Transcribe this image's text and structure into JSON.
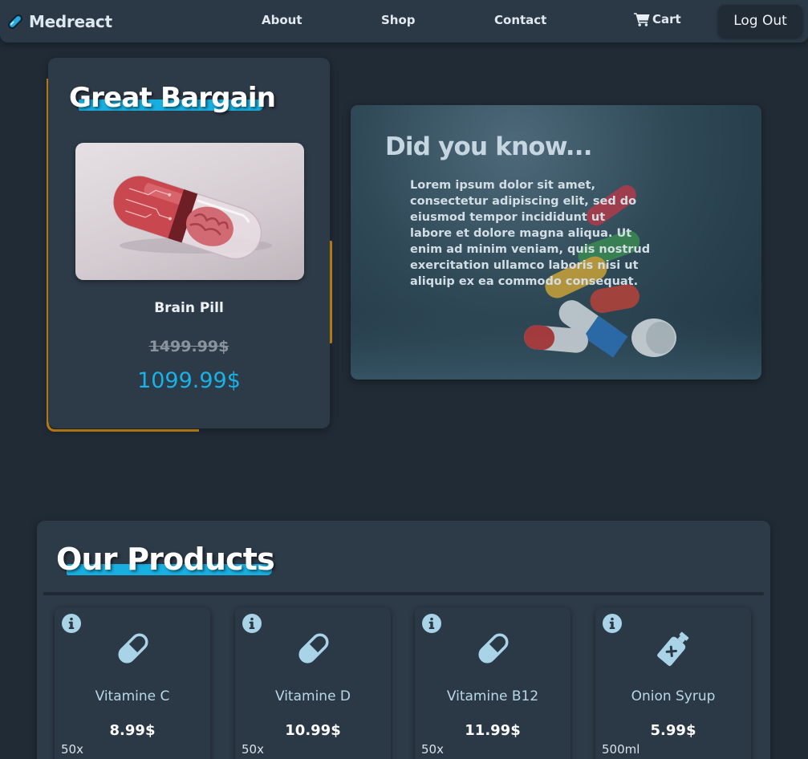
{
  "navbar": {
    "brand": "Medreact",
    "links": {
      "about": "About",
      "shop": "Shop",
      "contact": "Contact",
      "cart": "Cart"
    },
    "logout": "Log Out"
  },
  "bargain": {
    "title": "Great Bargain",
    "product_name": "Brain Pill",
    "old_price": "1499.99$",
    "new_price": "1099.99$"
  },
  "did_you_know": {
    "title": "Did you know...",
    "text": "Lorem ipsum dolor sit amet, consectetur adipiscing elit, sed do eiusmod tempor incididunt ut labore et dolore magna aliqua. Ut enim ad minim veniam, quis nostrud exercitation ullamco laboris nisi ut aliquip ex ea commodo consequat."
  },
  "products": {
    "title": "Our Products",
    "items": [
      {
        "name": "Vitamine C",
        "price": "8.99$",
        "qty": "50x",
        "icon": "pill-icon"
      },
      {
        "name": "Vitamine D",
        "price": "10.99$",
        "qty": "50x",
        "icon": "pill-icon"
      },
      {
        "name": "Vitamine B12",
        "price": "11.99$",
        "qty": "50x",
        "icon": "pill-icon"
      },
      {
        "name": "Onion Syrup",
        "price": "5.99$",
        "qty": "500ml",
        "icon": "syrup-bottle-icon"
      }
    ]
  },
  "colors": {
    "background": "#212b35",
    "card": "#2d3a48",
    "accent": "#18aee0",
    "bargain_border": "#d08c17",
    "icon": "#a9d3e6"
  }
}
